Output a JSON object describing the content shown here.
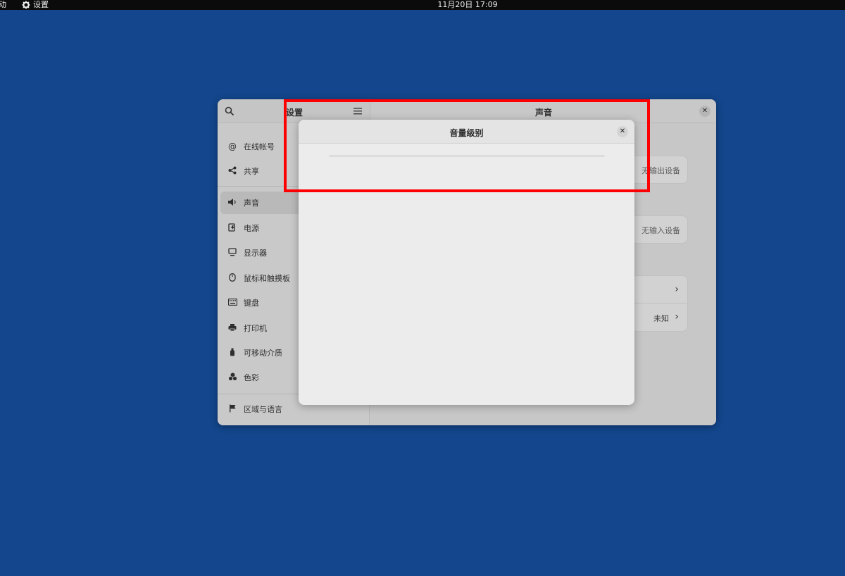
{
  "topbar": {
    "activities_label": "动",
    "app_name": "设置",
    "clock": "11月20日  17:09"
  },
  "settings_window": {
    "sidebar_title": "设置",
    "main_title": "声音",
    "sidebar_items": [
      {
        "label": "在线帐号",
        "icon": "at-icon"
      },
      {
        "label": "共享",
        "icon": "share-icon"
      },
      {
        "label": "声音",
        "icon": "speaker-icon",
        "active": true
      },
      {
        "label": "电源",
        "icon": "power-icon"
      },
      {
        "label": "显示器",
        "icon": "display-icon"
      },
      {
        "label": "鼠标和触摸板",
        "icon": "mouse-icon"
      },
      {
        "label": "键盘",
        "icon": "keyboard-icon"
      },
      {
        "label": "打印机",
        "icon": "printer-icon"
      },
      {
        "label": "可移动介质",
        "icon": "usb-icon"
      },
      {
        "label": "色彩",
        "icon": "color-icon"
      },
      {
        "label": "区域与语言",
        "icon": "flag-icon"
      }
    ],
    "output_device_text": "无输出设备",
    "input_device_text": "无输入设备",
    "unknown_label": "未知"
  },
  "dialog": {
    "title": "音量级别"
  },
  "colors": {
    "desktop": "#13468c",
    "highlight": "#ff0000"
  }
}
